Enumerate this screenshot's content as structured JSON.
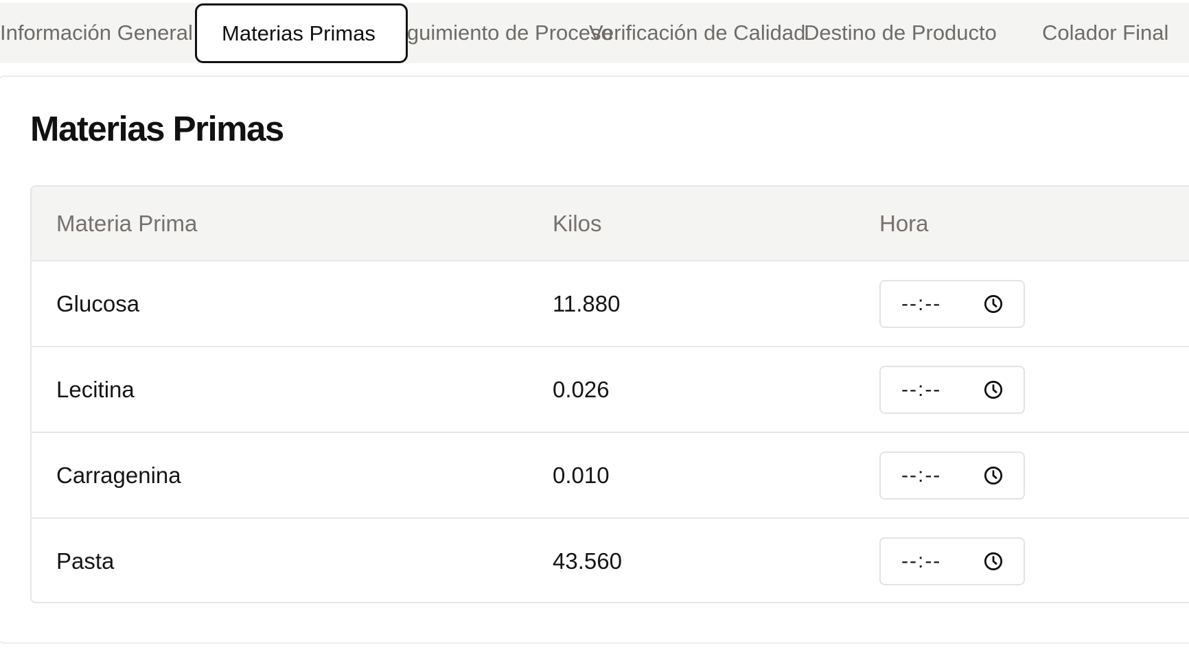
{
  "tabs": [
    {
      "label": "Información General",
      "active": false
    },
    {
      "label": "Materias Primas",
      "active": true
    },
    {
      "label": "Seguimiento de Proceso",
      "active": false
    },
    {
      "label": "Verificación de Calidad",
      "active": false
    },
    {
      "label": "Destino de Producto",
      "active": false
    },
    {
      "label": "Colador Final",
      "active": false
    }
  ],
  "section": {
    "title": "Materias Primas"
  },
  "table": {
    "headers": {
      "materia_prima": "Materia Prima",
      "kilos": "Kilos",
      "hora": "Hora"
    },
    "rows": [
      {
        "materia_prima": "Glucosa",
        "kilos": "11.880",
        "hora": "--:--"
      },
      {
        "materia_prima": "Lecitina",
        "kilos": "0.026",
        "hora": "--:--"
      },
      {
        "materia_prima": "Carragenina",
        "kilos": "0.010",
        "hora": "--:--"
      },
      {
        "materia_prima": "Pasta",
        "kilos": "43.560",
        "hora": "--:--"
      }
    ]
  },
  "icons": {
    "time_field": "clock-icon"
  }
}
